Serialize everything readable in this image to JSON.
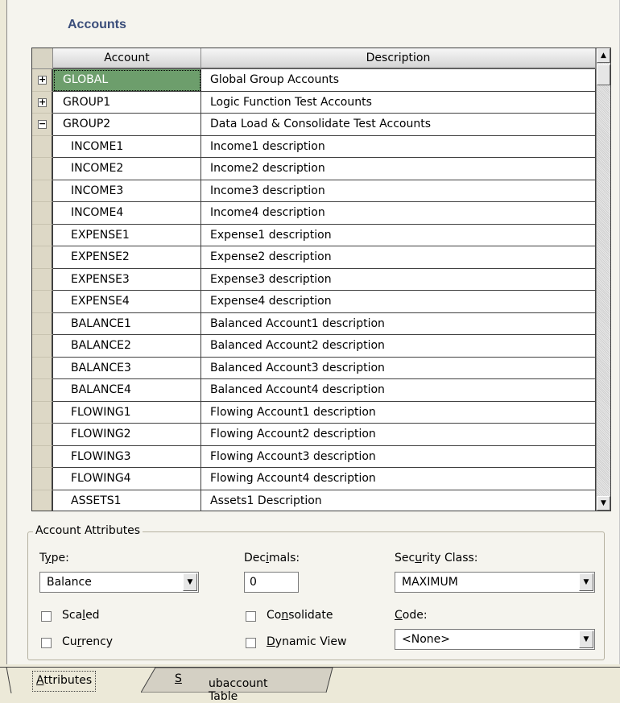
{
  "section_title": "Accounts",
  "grid": {
    "columns": [
      "Account",
      "Description"
    ],
    "rows": [
      {
        "account": "GLOBAL",
        "description": "Global Group Accounts",
        "toggle": "+",
        "selected": true,
        "child": false
      },
      {
        "account": "GROUP1",
        "description": "Logic Function Test Accounts",
        "toggle": "+",
        "selected": false,
        "child": false
      },
      {
        "account": "GROUP2",
        "description": "Data Load & Consolidate Test Accounts",
        "toggle": "−",
        "selected": false,
        "child": false
      },
      {
        "account": "INCOME1",
        "description": "Income1 description",
        "toggle": "",
        "selected": false,
        "child": true
      },
      {
        "account": "INCOME2",
        "description": "Income2 description",
        "toggle": "",
        "selected": false,
        "child": true
      },
      {
        "account": "INCOME3",
        "description": "Income3 description",
        "toggle": "",
        "selected": false,
        "child": true
      },
      {
        "account": "INCOME4",
        "description": "Income4 description",
        "toggle": "",
        "selected": false,
        "child": true
      },
      {
        "account": "EXPENSE1",
        "description": "Expense1 description",
        "toggle": "",
        "selected": false,
        "child": true
      },
      {
        "account": "EXPENSE2",
        "description": "Expense2 description",
        "toggle": "",
        "selected": false,
        "child": true
      },
      {
        "account": "EXPENSE3",
        "description": "Expense3 description",
        "toggle": "",
        "selected": false,
        "child": true
      },
      {
        "account": "EXPENSE4",
        "description": "Expense4 description",
        "toggle": "",
        "selected": false,
        "child": true
      },
      {
        "account": "BALANCE1",
        "description": "Balanced Account1 description",
        "toggle": "",
        "selected": false,
        "child": true
      },
      {
        "account": "BALANCE2",
        "description": "Balanced Account2 description",
        "toggle": "",
        "selected": false,
        "child": true
      },
      {
        "account": "BALANCE3",
        "description": "Balanced Account3 description",
        "toggle": "",
        "selected": false,
        "child": true
      },
      {
        "account": "BALANCE4",
        "description": "Balanced Account4 description",
        "toggle": "",
        "selected": false,
        "child": true
      },
      {
        "account": "FLOWING1",
        "description": "Flowing Account1 description",
        "toggle": "",
        "selected": false,
        "child": true
      },
      {
        "account": "FLOWING2",
        "description": "Flowing Account2 description",
        "toggle": "",
        "selected": false,
        "child": true
      },
      {
        "account": "FLOWING3",
        "description": "Flowing Account3 description",
        "toggle": "",
        "selected": false,
        "child": true
      },
      {
        "account": "FLOWING4",
        "description": "Flowing Account4 description",
        "toggle": "",
        "selected": false,
        "child": true
      },
      {
        "account": "ASSETS1",
        "description": "Assets1 Description",
        "toggle": "",
        "selected": false,
        "child": true
      }
    ]
  },
  "attributes": {
    "legend": "Account Attributes",
    "type": {
      "label_pre": "T",
      "label_u": "y",
      "label_post": "pe:",
      "value": "Balance"
    },
    "decimals": {
      "label_pre": "Dec",
      "label_u": "i",
      "label_post": "mals:",
      "value": "0"
    },
    "security_class": {
      "label_pre": "Sec",
      "label_u": "u",
      "label_post": "rity Class:",
      "value": "MAXIMUM"
    },
    "code": {
      "label_pre": "",
      "label_u": "C",
      "label_post": "ode:",
      "value": "<None>"
    },
    "checkboxes": {
      "scaled": {
        "pre": "Sca",
        "u": "l",
        "post": "ed",
        "checked": false
      },
      "currency": {
        "pre": "Cu",
        "u": "r",
        "post": "rency",
        "checked": false
      },
      "consolidate": {
        "pre": "Co",
        "u": "n",
        "post": "solidate",
        "checked": false
      },
      "dynamic_view": {
        "pre": "",
        "u": "D",
        "post": "ynamic View",
        "checked": false
      }
    }
  },
  "tabs": {
    "attributes": {
      "u": "A",
      "rest": "ttributes"
    },
    "subaccount": {
      "u": "S",
      "rest": "ubaccount Table"
    }
  },
  "icons": {
    "expand": "plus-box-icon",
    "collapse": "minus-box-icon",
    "dropdown": "triangle-down-icon",
    "scroll_up": "triangle-up-icon",
    "scroll_down": "triangle-down-icon"
  }
}
